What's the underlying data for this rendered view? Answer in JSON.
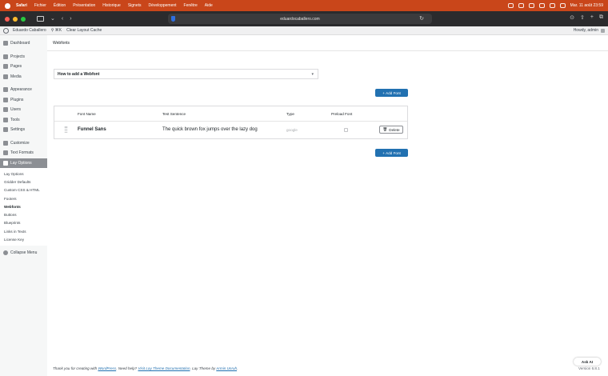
{
  "menubar": {
    "app": "Safari",
    "items": [
      "Fichier",
      "Édition",
      "Présentation",
      "Historique",
      "Signets",
      "Développement",
      "Fenêtre",
      "Aide"
    ],
    "clock": "Mar. 11 août  23:59"
  },
  "browser": {
    "url": "eduardocaballero.com"
  },
  "adminbar": {
    "site_name": "Eduardo Caballero",
    "shortcut": "⌘K",
    "clear_cache": "Clear Layout Cache",
    "greeting": "Howdy, admin"
  },
  "sidebar": {
    "items": [
      {
        "label": "Dashboard"
      },
      {
        "label": "Projects"
      },
      {
        "label": "Pages"
      },
      {
        "label": "Media"
      },
      {
        "label": "Appearance"
      },
      {
        "label": "Plugins"
      },
      {
        "label": "Users"
      },
      {
        "label": "Tools"
      },
      {
        "label": "Settings"
      },
      {
        "label": "Customize"
      },
      {
        "label": "Text Formats"
      },
      {
        "label": "Lay Options"
      }
    ],
    "submenu": [
      "Lay Options",
      "Gridder Defaults",
      "Custom CSS & HTML",
      "Footers",
      "Webfonts",
      "Buttons",
      "Blueprints",
      "Links in Texts",
      "License Key"
    ],
    "collapse": "Collapse Menu"
  },
  "main": {
    "page_title": "Webfonts",
    "howto_label": "How to add a Webfont",
    "howto_chevron": "▾",
    "add_font_label": "Add Font",
    "table": {
      "headers": [
        "Font Name",
        "Test Sentence",
        "Type",
        "Preload Font"
      ],
      "rows": [
        {
          "name": "Funnel Sans",
          "sentence": "The quick brown fox jumps over the lazy dog",
          "type": "google",
          "delete_label": "Delete"
        }
      ]
    },
    "footer": {
      "p1": "Thank you for creating with ",
      "link1": "WordPress",
      "p2": ". Need help? ",
      "link2": "Visit Lay Theme Documentation",
      "p3": ". Lay Theme by ",
      "link3": "Armin Unruh",
      "p4": "."
    },
    "ask_ai": "Ask AI",
    "version": "Version 6.8.1"
  }
}
